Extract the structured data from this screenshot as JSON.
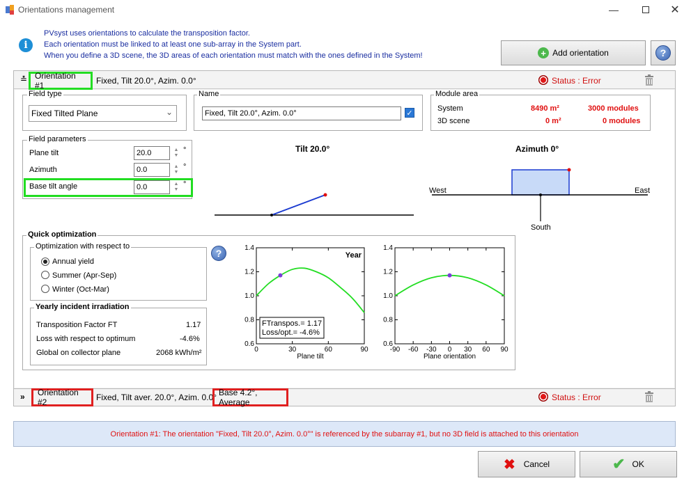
{
  "window": {
    "title": "Orientations management"
  },
  "info": {
    "lines": [
      "PVsyst uses orientations to calculate the transposition factor.",
      "Each orientation must be linked to at least one sub-array in the System part.",
      "When you define a 3D scene, the 3D areas of each orientation must match with the ones defined in the System!"
    ]
  },
  "toolbar": {
    "add_orientation": "Add orientation"
  },
  "orientation1": {
    "name": "Orientation #1",
    "summary": "Fixed, Tilt 20.0°, Azim. 0.0°",
    "status": "Status : Error",
    "field_type_label": "Field type",
    "field_type_value": "Fixed Tilted Plane",
    "name_label": "Name",
    "name_value": "Fixed, Tilt 20.0°, Azim. 0.0°",
    "module_area": {
      "label": "Module area",
      "system_label": "System",
      "system_area": "8490 m²",
      "system_modules": "3000 modules",
      "scene_label": "3D scene",
      "scene_area": "0 m²",
      "scene_modules": "0 modules"
    },
    "field_params": {
      "label": "Field parameters",
      "plane_tilt_label": "Plane tilt",
      "plane_tilt_value": "20.0",
      "azimuth_label": "Azimuth",
      "azimuth_value": "0.0",
      "base_tilt_label": "Base tilt angle",
      "base_tilt_value": "0.0",
      "unit": "°"
    },
    "tilt_diagram": {
      "title": "Tilt 20.0°"
    },
    "azimuth_diagram": {
      "title": "Azimuth 0°",
      "west": "West",
      "east": "East",
      "south": "South"
    }
  },
  "quick_opt": {
    "title": "Quick optimization",
    "respect_label": "Optimization with respect to",
    "options": [
      "Annual yield",
      "Summer (Apr-Sep)",
      "Winter (Oct-Mar)"
    ],
    "selected": 0,
    "yearly_title": "Yearly incident irradiation",
    "rows": [
      {
        "label": "Transposition Factor FT",
        "value": "1.17"
      },
      {
        "label": "Loss with respect to optimum",
        "value": "-4.6%"
      },
      {
        "label": "Global on collector plane",
        "value": "2068 kWh/m²"
      }
    ]
  },
  "chart_data": [
    {
      "type": "line",
      "title": "Year",
      "xlabel": "Plane tilt",
      "ylabel": "",
      "xlim": [
        0,
        90
      ],
      "ylim": [
        0.6,
        1.4
      ],
      "xticks": [
        "0",
        "30",
        "60",
        "90"
      ],
      "yticks": [
        "0.6",
        "0.8",
        "1.0",
        "1.2",
        "1.4"
      ],
      "x": [
        0,
        10,
        20,
        30,
        40,
        50,
        60,
        70,
        80,
        90
      ],
      "y": [
        1.0,
        1.1,
        1.17,
        1.22,
        1.23,
        1.2,
        1.15,
        1.07,
        0.98,
        0.86
      ],
      "marker": {
        "x": 20,
        "y": 1.17
      },
      "annotation": [
        "FTranspos.= 1.17",
        "Loss/opt.= -4.6%"
      ],
      "colors": {
        "line": "#22dd22",
        "marker": "#7a3dd8"
      }
    },
    {
      "type": "line",
      "title": "",
      "xlabel": "Plane orientation",
      "ylabel": "",
      "xlim": [
        -90,
        90
      ],
      "ylim": [
        0.6,
        1.4
      ],
      "xticks": [
        "-90",
        "-60",
        "-30",
        "0",
        "30",
        "60",
        "90"
      ],
      "yticks": [
        "0.6",
        "0.8",
        "1.0",
        "1.2",
        "1.4"
      ],
      "x": [
        -90,
        -60,
        -30,
        0,
        30,
        60,
        90
      ],
      "y": [
        1.0,
        1.09,
        1.15,
        1.17,
        1.15,
        1.09,
        1.0
      ],
      "marker": {
        "x": 0,
        "y": 1.17
      },
      "colors": {
        "line": "#22dd22",
        "marker": "#7a3dd8"
      }
    }
  ],
  "orientation2": {
    "name": "Orientation #2",
    "summary": "Fixed, Tilt aver. 20.0°, Azim. 0.0°",
    "base": "Base 4.2°, Average",
    "status": "Status : Error"
  },
  "error_message": "Orientation #1: The orientation \"Fixed, Tilt 20.0°, Azim. 0.0°\" is referenced by the subarray #1, but no 3D field is attached to this orientation",
  "footer": {
    "cancel": "Cancel",
    "ok": "OK"
  },
  "colors": {
    "error": "#e01010",
    "highlight_green": "#22dd22",
    "highlight_red": "#e02020",
    "info_text": "#1a2ea0"
  }
}
